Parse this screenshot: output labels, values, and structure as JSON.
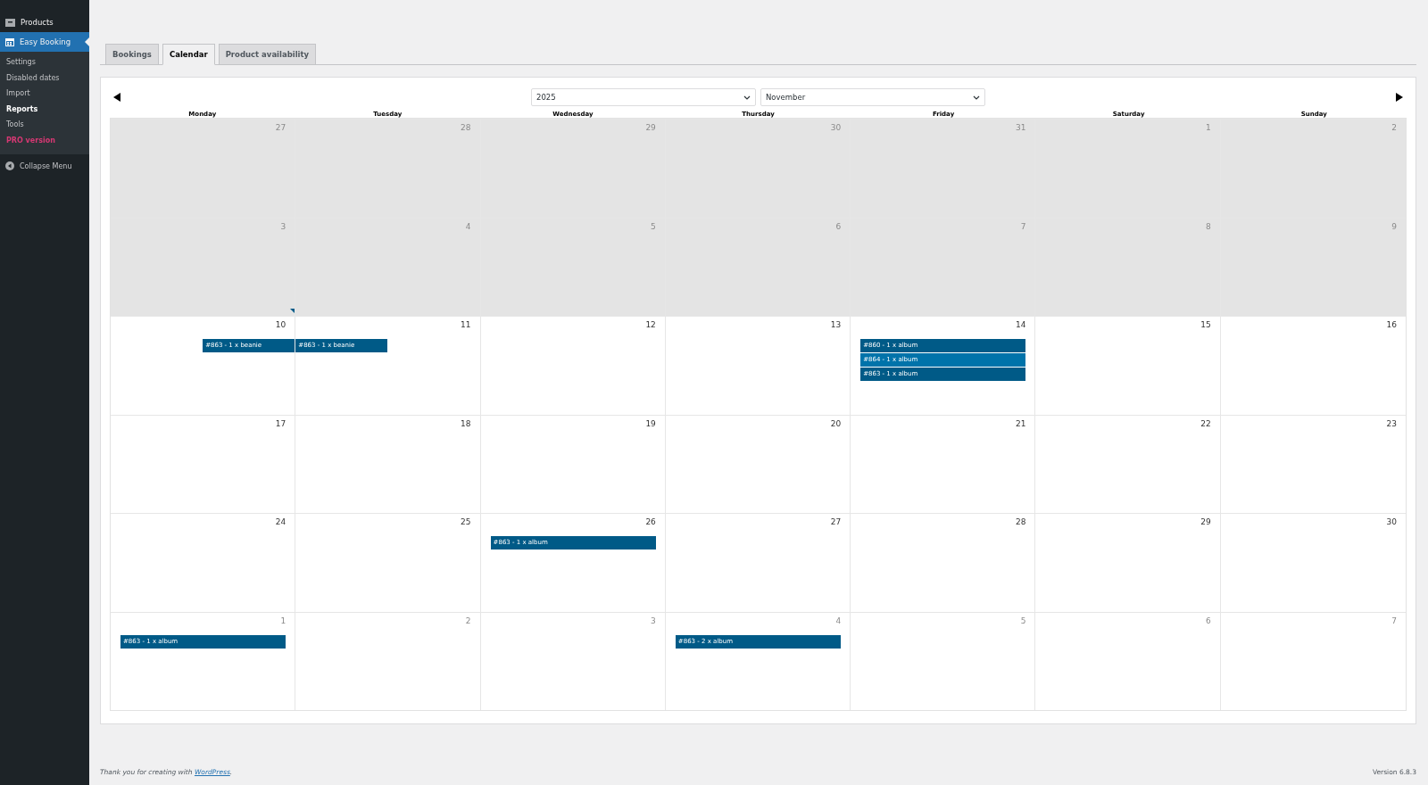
{
  "sidebar": {
    "menu": [
      {
        "label": "Products",
        "selected": false,
        "kind": "products"
      },
      {
        "label": "Easy Booking",
        "selected": true,
        "kind": "calendar"
      }
    ],
    "submenu": [
      {
        "label": "Settings",
        "selected": false,
        "kind": "link"
      },
      {
        "label": "Disabled dates",
        "selected": false,
        "kind": "link"
      },
      {
        "label": "Import",
        "selected": false,
        "kind": "link"
      },
      {
        "label": "Reports",
        "selected": true,
        "kind": "link"
      },
      {
        "label": "Tools",
        "selected": false,
        "kind": "link"
      },
      {
        "label": "PRO version",
        "selected": false,
        "kind": "promo"
      }
    ],
    "collapse": "Collapse Menu"
  },
  "tabs": [
    {
      "label": "Bookings",
      "selected": false
    },
    {
      "label": "Calendar",
      "selected": true
    },
    {
      "label": "Product availability",
      "selected": false
    }
  ],
  "calendar": {
    "year": "2025",
    "month": "November",
    "weekdays": [
      "Monday",
      "Tuesday",
      "Wednesday",
      "Thursday",
      "Friday",
      "Saturday",
      "Sunday"
    ],
    "weeks": [
      {
        "past": true,
        "days": [
          {
            "label": "27",
            "muted": true,
            "today": false
          },
          {
            "label": "28",
            "muted": true,
            "today": false
          },
          {
            "label": "29",
            "muted": true,
            "today": false
          },
          {
            "label": "30",
            "muted": true,
            "today": false
          },
          {
            "label": "31",
            "muted": true,
            "today": false
          },
          {
            "label": "1",
            "muted": true,
            "today": false
          },
          {
            "label": "2",
            "muted": true,
            "today": false
          }
        ]
      },
      {
        "past": true,
        "days": [
          {
            "label": "3",
            "muted": true,
            "today": false
          },
          {
            "label": "4",
            "muted": true,
            "today": false
          },
          {
            "label": "5",
            "muted": true,
            "today": false
          },
          {
            "label": "6",
            "muted": true,
            "today": false
          },
          {
            "label": "7",
            "muted": true,
            "today": false
          },
          {
            "label": "8",
            "muted": true,
            "today": false
          },
          {
            "label": "9",
            "muted": true,
            "today": false
          }
        ]
      },
      {
        "past": false,
        "days": [
          {
            "label": "10",
            "muted": false,
            "today": true,
            "events": [
              {
                "label": "#863 - 1 x beanie",
                "kind": "late",
                "color": "#005a87"
              }
            ]
          },
          {
            "label": "11",
            "muted": false,
            "today": false,
            "events": [
              {
                "label": "#863 - 1 x beanie",
                "kind": "early",
                "color": "#005a87"
              }
            ]
          },
          {
            "label": "12",
            "muted": false,
            "today": false
          },
          {
            "label": "13",
            "muted": false,
            "today": false
          },
          {
            "label": "14",
            "muted": false,
            "today": false,
            "events": [
              {
                "label": "#860 - 1 x album",
                "kind": "full",
                "color": "#005a87"
              },
              {
                "label": "#864 - 1 x album",
                "kind": "full",
                "color": "#0073aa"
              },
              {
                "label": "#863 - 1 x album",
                "kind": "full",
                "color": "#005a87"
              }
            ]
          },
          {
            "label": "15",
            "muted": false,
            "today": false
          },
          {
            "label": "16",
            "muted": false,
            "today": false
          }
        ]
      },
      {
        "past": false,
        "days": [
          {
            "label": "17",
            "muted": false,
            "today": false
          },
          {
            "label": "18",
            "muted": false,
            "today": false
          },
          {
            "label": "19",
            "muted": false,
            "today": false
          },
          {
            "label": "20",
            "muted": false,
            "today": false
          },
          {
            "label": "21",
            "muted": false,
            "today": false
          },
          {
            "label": "22",
            "muted": false,
            "today": false
          },
          {
            "label": "23",
            "muted": false,
            "today": false
          }
        ]
      },
      {
        "past": false,
        "days": [
          {
            "label": "24",
            "muted": false,
            "today": false
          },
          {
            "label": "25",
            "muted": false,
            "today": false
          },
          {
            "label": "26",
            "muted": false,
            "today": false,
            "events": [
              {
                "label": "#863 - 1 x album",
                "kind": "full",
                "color": "#005a87"
              }
            ]
          },
          {
            "label": "27",
            "muted": false,
            "today": false
          },
          {
            "label": "28",
            "muted": false,
            "today": false
          },
          {
            "label": "29",
            "muted": false,
            "today": false
          },
          {
            "label": "30",
            "muted": false,
            "today": false
          }
        ]
      },
      {
        "past": false,
        "days": [
          {
            "label": "1",
            "muted": true,
            "today": false,
            "events": [
              {
                "label": "#863 - 1 x album",
                "kind": "full",
                "color": "#005a87"
              }
            ]
          },
          {
            "label": "2",
            "muted": true,
            "today": false
          },
          {
            "label": "3",
            "muted": true,
            "today": false
          },
          {
            "label": "4",
            "muted": true,
            "today": false,
            "events": [
              {
                "label": "#863 - 2 x album",
                "kind": "full",
                "color": "#005a87"
              }
            ]
          },
          {
            "label": "5",
            "muted": true,
            "today": false
          },
          {
            "label": "6",
            "muted": true,
            "today": false
          },
          {
            "label": "7",
            "muted": true,
            "today": false
          }
        ]
      }
    ]
  },
  "footer": {
    "thanks": "Thank you for creating with ",
    "link": "WordPress",
    "end": ".",
    "version": "Version 6.8.3"
  }
}
